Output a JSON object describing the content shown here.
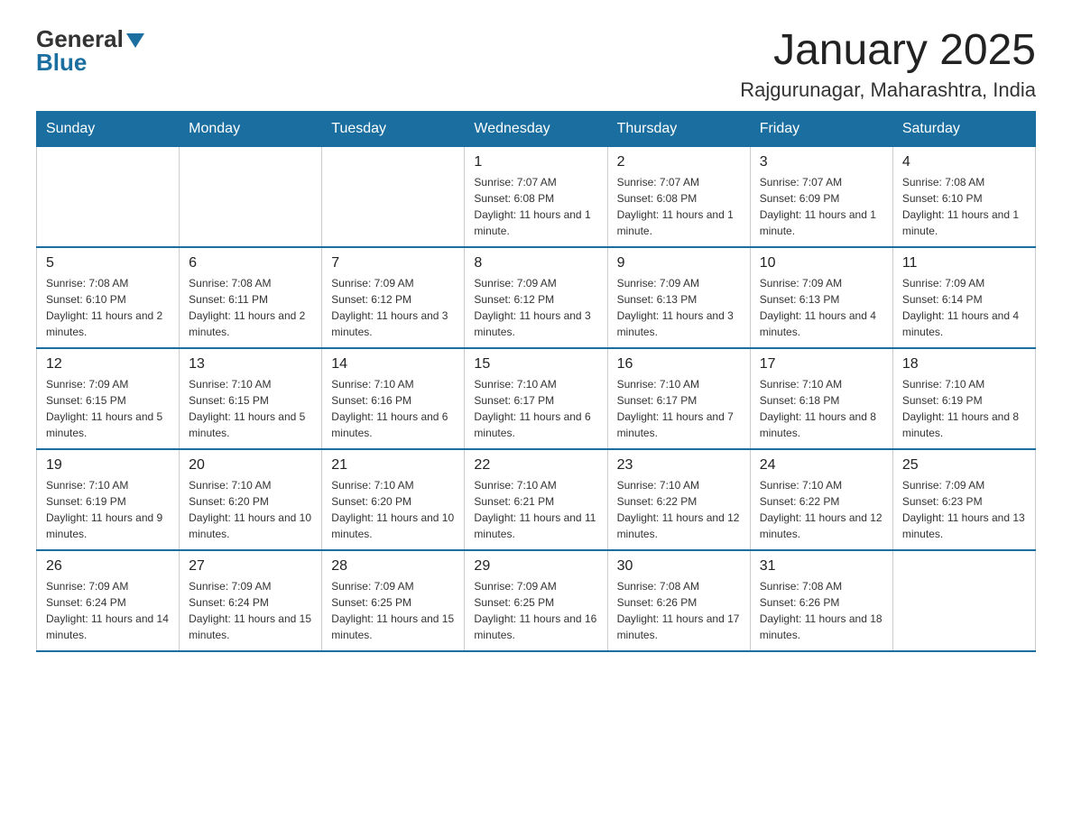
{
  "header": {
    "logo_general": "General",
    "logo_blue": "Blue",
    "title": "January 2025",
    "subtitle": "Rajgurunagar, Maharashtra, India"
  },
  "weekdays": [
    "Sunday",
    "Monday",
    "Tuesday",
    "Wednesday",
    "Thursday",
    "Friday",
    "Saturday"
  ],
  "weeks": [
    [
      {
        "day": "",
        "info": ""
      },
      {
        "day": "",
        "info": ""
      },
      {
        "day": "",
        "info": ""
      },
      {
        "day": "1",
        "info": "Sunrise: 7:07 AM\nSunset: 6:08 PM\nDaylight: 11 hours and 1 minute."
      },
      {
        "day": "2",
        "info": "Sunrise: 7:07 AM\nSunset: 6:08 PM\nDaylight: 11 hours and 1 minute."
      },
      {
        "day": "3",
        "info": "Sunrise: 7:07 AM\nSunset: 6:09 PM\nDaylight: 11 hours and 1 minute."
      },
      {
        "day": "4",
        "info": "Sunrise: 7:08 AM\nSunset: 6:10 PM\nDaylight: 11 hours and 1 minute."
      }
    ],
    [
      {
        "day": "5",
        "info": "Sunrise: 7:08 AM\nSunset: 6:10 PM\nDaylight: 11 hours and 2 minutes."
      },
      {
        "day": "6",
        "info": "Sunrise: 7:08 AM\nSunset: 6:11 PM\nDaylight: 11 hours and 2 minutes."
      },
      {
        "day": "7",
        "info": "Sunrise: 7:09 AM\nSunset: 6:12 PM\nDaylight: 11 hours and 3 minutes."
      },
      {
        "day": "8",
        "info": "Sunrise: 7:09 AM\nSunset: 6:12 PM\nDaylight: 11 hours and 3 minutes."
      },
      {
        "day": "9",
        "info": "Sunrise: 7:09 AM\nSunset: 6:13 PM\nDaylight: 11 hours and 3 minutes."
      },
      {
        "day": "10",
        "info": "Sunrise: 7:09 AM\nSunset: 6:13 PM\nDaylight: 11 hours and 4 minutes."
      },
      {
        "day": "11",
        "info": "Sunrise: 7:09 AM\nSunset: 6:14 PM\nDaylight: 11 hours and 4 minutes."
      }
    ],
    [
      {
        "day": "12",
        "info": "Sunrise: 7:09 AM\nSunset: 6:15 PM\nDaylight: 11 hours and 5 minutes."
      },
      {
        "day": "13",
        "info": "Sunrise: 7:10 AM\nSunset: 6:15 PM\nDaylight: 11 hours and 5 minutes."
      },
      {
        "day": "14",
        "info": "Sunrise: 7:10 AM\nSunset: 6:16 PM\nDaylight: 11 hours and 6 minutes."
      },
      {
        "day": "15",
        "info": "Sunrise: 7:10 AM\nSunset: 6:17 PM\nDaylight: 11 hours and 6 minutes."
      },
      {
        "day": "16",
        "info": "Sunrise: 7:10 AM\nSunset: 6:17 PM\nDaylight: 11 hours and 7 minutes."
      },
      {
        "day": "17",
        "info": "Sunrise: 7:10 AM\nSunset: 6:18 PM\nDaylight: 11 hours and 8 minutes."
      },
      {
        "day": "18",
        "info": "Sunrise: 7:10 AM\nSunset: 6:19 PM\nDaylight: 11 hours and 8 minutes."
      }
    ],
    [
      {
        "day": "19",
        "info": "Sunrise: 7:10 AM\nSunset: 6:19 PM\nDaylight: 11 hours and 9 minutes."
      },
      {
        "day": "20",
        "info": "Sunrise: 7:10 AM\nSunset: 6:20 PM\nDaylight: 11 hours and 10 minutes."
      },
      {
        "day": "21",
        "info": "Sunrise: 7:10 AM\nSunset: 6:20 PM\nDaylight: 11 hours and 10 minutes."
      },
      {
        "day": "22",
        "info": "Sunrise: 7:10 AM\nSunset: 6:21 PM\nDaylight: 11 hours and 11 minutes."
      },
      {
        "day": "23",
        "info": "Sunrise: 7:10 AM\nSunset: 6:22 PM\nDaylight: 11 hours and 12 minutes."
      },
      {
        "day": "24",
        "info": "Sunrise: 7:10 AM\nSunset: 6:22 PM\nDaylight: 11 hours and 12 minutes."
      },
      {
        "day": "25",
        "info": "Sunrise: 7:09 AM\nSunset: 6:23 PM\nDaylight: 11 hours and 13 minutes."
      }
    ],
    [
      {
        "day": "26",
        "info": "Sunrise: 7:09 AM\nSunset: 6:24 PM\nDaylight: 11 hours and 14 minutes."
      },
      {
        "day": "27",
        "info": "Sunrise: 7:09 AM\nSunset: 6:24 PM\nDaylight: 11 hours and 15 minutes."
      },
      {
        "day": "28",
        "info": "Sunrise: 7:09 AM\nSunset: 6:25 PM\nDaylight: 11 hours and 15 minutes."
      },
      {
        "day": "29",
        "info": "Sunrise: 7:09 AM\nSunset: 6:25 PM\nDaylight: 11 hours and 16 minutes."
      },
      {
        "day": "30",
        "info": "Sunrise: 7:08 AM\nSunset: 6:26 PM\nDaylight: 11 hours and 17 minutes."
      },
      {
        "day": "31",
        "info": "Sunrise: 7:08 AM\nSunset: 6:26 PM\nDaylight: 11 hours and 18 minutes."
      },
      {
        "day": "",
        "info": ""
      }
    ]
  ]
}
